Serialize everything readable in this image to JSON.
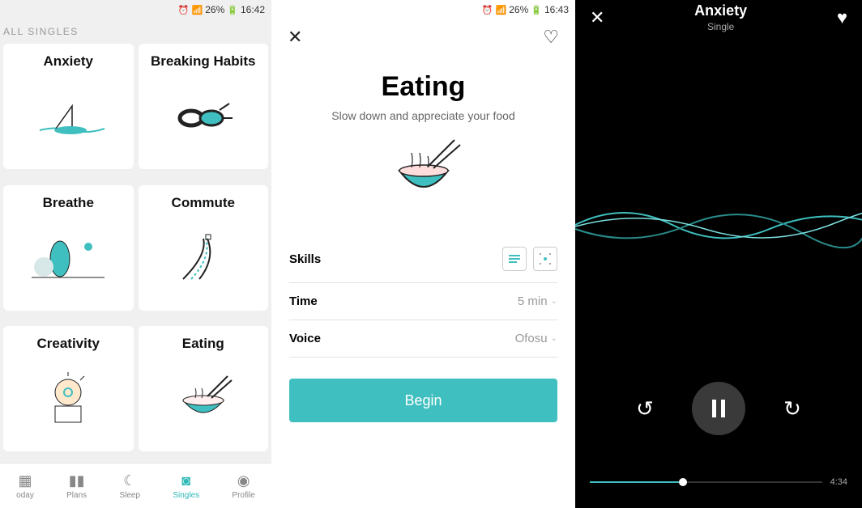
{
  "status": {
    "battery": "26%",
    "time1": "16:42",
    "time2": "16:43"
  },
  "screen1": {
    "header": "ALL SINGLES",
    "cards": [
      "Anxiety",
      "Breaking Habits",
      "Breathe",
      "Commute",
      "Creativity",
      "Eating"
    ],
    "nav": [
      {
        "label": "oday"
      },
      {
        "label": "Plans"
      },
      {
        "label": "Sleep"
      },
      {
        "label": "Singles"
      },
      {
        "label": "Profile"
      }
    ]
  },
  "screen2": {
    "title": "Eating",
    "subtitle": "Slow down and appreciate your food",
    "rows": [
      {
        "label": "Skills",
        "value": ""
      },
      {
        "label": "Time",
        "value": "5 min"
      },
      {
        "label": "Voice",
        "value": "Ofosu"
      }
    ],
    "cta": "Begin"
  },
  "screen3": {
    "title": "Anxiety",
    "subtitle": "Single",
    "progress": 0.4,
    "total": "4:34"
  }
}
